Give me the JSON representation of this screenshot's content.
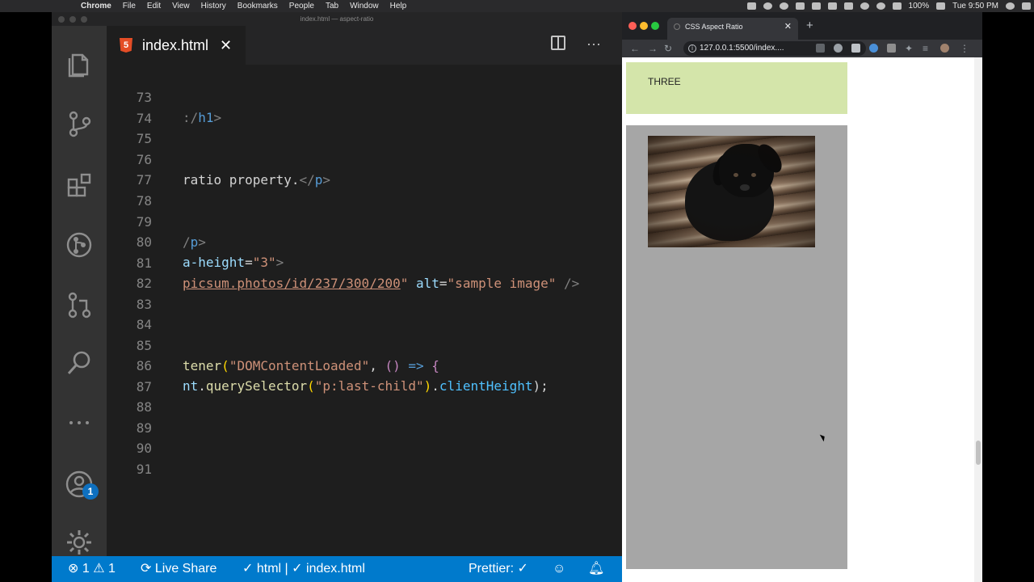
{
  "menubar": {
    "app": "Chrome",
    "items": [
      "File",
      "Edit",
      "View",
      "History",
      "Bookmarks",
      "People",
      "Tab",
      "Window",
      "Help"
    ],
    "battery": "100%",
    "clock": "Tue 9:50 PM"
  },
  "vscode": {
    "window_title": "index.html — aspect-ratio",
    "tab": {
      "label": "index.html",
      "close": "✕",
      "icon": "html5-icon"
    },
    "lines": [
      {
        "n": "73"
      },
      {
        "n": "74"
      },
      {
        "n": "75"
      },
      {
        "n": "76"
      },
      {
        "n": "77"
      },
      {
        "n": "78"
      },
      {
        "n": "79"
      },
      {
        "n": "80"
      },
      {
        "n": "81"
      },
      {
        "n": "82"
      },
      {
        "n": "83"
      },
      {
        "n": "84"
      },
      {
        "n": "85"
      },
      {
        "n": "86"
      },
      {
        "n": "87"
      },
      {
        "n": "88"
      },
      {
        "n": "89"
      },
      {
        "n": "90"
      },
      {
        "n": "91"
      }
    ],
    "code": {
      "l73_tag": ":/",
      "l73_el": "h1",
      "l73_end": ">",
      "l76_text": "ratio property.",
      "l76_close_open": "</",
      "l76_el": "p",
      "l76_close_end": ">",
      "l79_slash": "/",
      "l79_el": "p",
      "l79_end": ">",
      "l80_attr": "a-height",
      "l80_eq": "=",
      "l80_val": "\"3\"",
      "l80_end": ">",
      "l81_url": "picsum.photos/id/237/300/200",
      "l81_q": "\"",
      "l81_attr": "alt",
      "l81_eq": "=",
      "l81_val": "\"sample image\"",
      "l81_end": "/>",
      "l85_fn": "tener",
      "l85_paren": "(",
      "l85_str": "\"DOMContentLoaded\"",
      "l85_comma": ",",
      "l85_arrowparens": "()",
      "l85_arrow": "=>",
      "l85_brace": "{",
      "l86_obj": "nt",
      "l86_dot1": ".",
      "l86_fn": "querySelector",
      "l86_paren": "(",
      "l86_str": "\"p:last-child\"",
      "l86_close": ")",
      "l86_dot2": ".",
      "l86_prop": "clientHeight",
      "l86_end": ");"
    },
    "status": {
      "errors": "1",
      "warnings": "1",
      "live_share": "Live Share",
      "html": "html",
      "sep": "|",
      "file": "index.html",
      "prettier": "Prettier: ✓"
    },
    "activity_badge": "1"
  },
  "chrome": {
    "tab_title": "CSS Aspect Ratio",
    "tab_close": "✕",
    "new_tab": "+",
    "url": "127.0.0.1:5500/index....",
    "page": {
      "three_label": "THREE",
      "image_alt": "sample image"
    }
  },
  "colors": {
    "vscode_accent": "#007acc",
    "box_three": "#d4e5aa",
    "box_gray": "#a6a6a6"
  }
}
